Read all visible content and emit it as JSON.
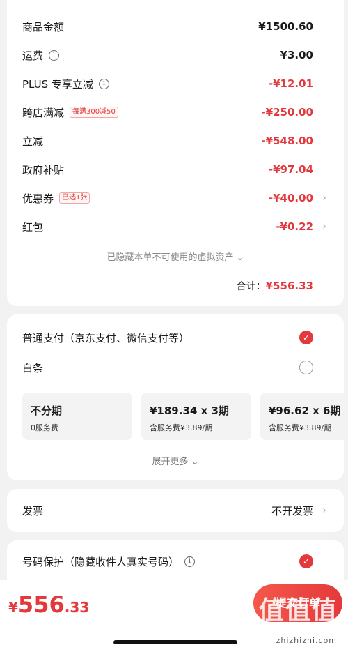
{
  "price_rows": [
    {
      "label": "商品金额",
      "value": "¥1500.60",
      "red": false,
      "info": false,
      "tag": "",
      "chevron": false
    },
    {
      "label": "运费",
      "value": "¥3.00",
      "red": false,
      "info": true,
      "tag": "",
      "chevron": false
    },
    {
      "label": "PLUS 专享立减",
      "value": "-¥12.01",
      "red": true,
      "info": true,
      "tag": "",
      "chevron": false
    },
    {
      "label": "跨店满减",
      "value": "-¥250.00",
      "red": true,
      "info": false,
      "tag": "每满300减50",
      "chevron": false
    },
    {
      "label": "立减",
      "value": "-¥548.00",
      "red": true,
      "info": false,
      "tag": "",
      "chevron": false
    },
    {
      "label": "政府补贴",
      "value": "-¥97.04",
      "red": true,
      "info": false,
      "tag": "",
      "chevron": false
    },
    {
      "label": "优惠券",
      "value": "-¥40.00",
      "red": true,
      "info": false,
      "tag": "已选1张",
      "chevron": true
    },
    {
      "label": "红包",
      "value": "-¥0.22",
      "red": true,
      "info": false,
      "tag": "",
      "chevron": true
    }
  ],
  "hidden_assets_label": "已隐藏本单不可使用的虚拟资产 ⌄",
  "total_label": "合计：",
  "total_value": "¥556.33",
  "payment": {
    "normal_label": "普通支付（京东支付、微信支付等）",
    "baitiao_label": "白条",
    "plans": [
      {
        "main": "不分期",
        "sub": "0服务费"
      },
      {
        "main": "¥189.34 x 3期",
        "sub": "含服务费¥3.89/期"
      },
      {
        "main": "¥96.62 x 6期",
        "sub": "含服务费¥3.89/期"
      }
    ],
    "expand_label": "展开更多 ⌄"
  },
  "invoice": {
    "label": "发票",
    "value": "不开发票"
  },
  "privacy": {
    "label": "号码保护（隐藏收件人真实号码）"
  },
  "bottom": {
    "yen": "¥",
    "amount_int": "556",
    "amount_dec": ".33",
    "submit_label": "提交订单",
    "watermark_glyphs": "值值值",
    "watermark_text": "zhizhizhi.com"
  },
  "colors": {
    "accent": "#e4393c"
  }
}
